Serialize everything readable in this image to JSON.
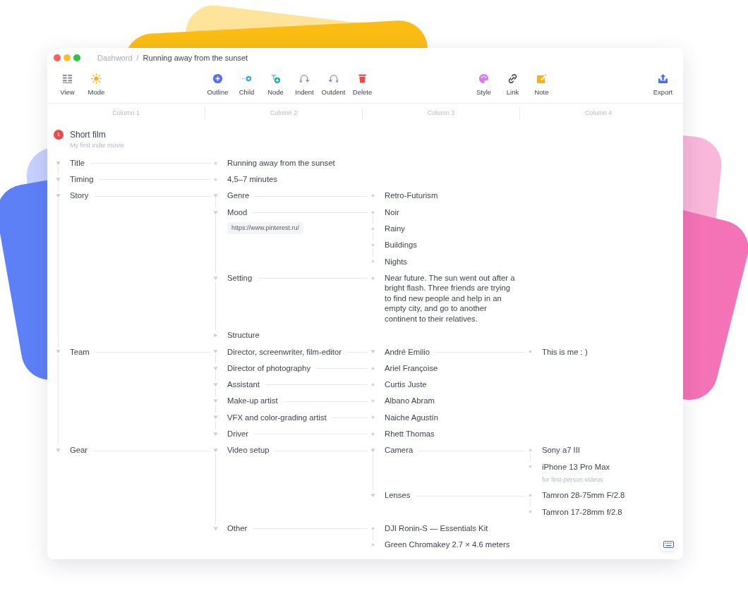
{
  "window": {
    "traffic_lights": [
      {
        "color": "#fe5f57"
      },
      {
        "color": "#febc2e"
      },
      {
        "color": "#28c840"
      }
    ],
    "breadcrumb": [
      {
        "label": "Dashword",
        "current": false
      },
      {
        "label": "Running away from the sunset",
        "current": true
      }
    ],
    "breadcrumb_separator": "/"
  },
  "toolbar": {
    "groups": [
      {
        "items": [
          {
            "label": "View"
          },
          {
            "label": "Mode"
          }
        ]
      },
      {
        "items": [
          {
            "label": "Outline"
          },
          {
            "label": "Child"
          },
          {
            "label": "Node"
          },
          {
            "label": "Indent"
          },
          {
            "label": "Outdent"
          },
          {
            "label": "Delete"
          }
        ]
      },
      {
        "items": [
          {
            "label": "Style"
          },
          {
            "label": "Link"
          },
          {
            "label": "Note"
          }
        ]
      },
      {
        "items": [
          {
            "label": "Export"
          }
        ]
      }
    ]
  },
  "columns": [
    "Column 1",
    "Column 2",
    "Column 3",
    "Column 4"
  ],
  "document": {
    "number": "1",
    "title": "Short film",
    "subtitle": "My first indie movie"
  },
  "tree": [
    {
      "label": "Title",
      "expanded": true,
      "children": [
        {
          "label": "Running away from the sunset"
        }
      ]
    },
    {
      "label": "Timing",
      "expanded": true,
      "children": [
        {
          "label": "4,5–7 minutes"
        }
      ]
    },
    {
      "label": "Story",
      "expanded": true,
      "children": [
        {
          "label": "Genre",
          "expanded": true,
          "children": [
            {
              "label": "Retro-Futurism"
            }
          ]
        },
        {
          "label": "Mood",
          "expanded": true,
          "link": "https://www.pinterest.ru/",
          "children": [
            {
              "label": "Noir"
            },
            {
              "label": "Rainy"
            },
            {
              "label": "Buildings"
            },
            {
              "label": "Nights"
            }
          ]
        },
        {
          "label": "Setting",
          "expanded": true,
          "children": [
            {
              "label": "Near future. The sun went out after a bright flash. Three friends are trying to find new people and help in an empty city, and go to another continent to their relatives."
            }
          ]
        },
        {
          "label": "Structure",
          "expanded": false
        }
      ]
    },
    {
      "label": "Team",
      "expanded": true,
      "children": [
        {
          "label": "Director, screenwriter, film-editor",
          "expanded": true,
          "children": [
            {
              "label": "André Emilio",
              "expanded": true,
              "children": [
                {
                  "label": "This is me : )"
                }
              ]
            }
          ]
        },
        {
          "label": "Director of photography",
          "expanded": true,
          "children": [
            {
              "label": "Ariel Françoise"
            }
          ]
        },
        {
          "label": "Assistant",
          "expanded": true,
          "children": [
            {
              "label": "Curtis Juste"
            }
          ]
        },
        {
          "label": "Make-up artist",
          "expanded": true,
          "children": [
            {
              "label": "Albano Abram"
            }
          ]
        },
        {
          "label": "VFX and color-grading artist",
          "expanded": true,
          "children": [
            {
              "label": "Naiche Agustín"
            }
          ]
        },
        {
          "label": "Driver",
          "expanded": true,
          "children": [
            {
              "label": "Rhett Thomas"
            }
          ]
        }
      ]
    },
    {
      "label": "Gear",
      "expanded": true,
      "children": [
        {
          "label": "Video setup",
          "expanded": true,
          "children": [
            {
              "label": "Camera",
              "expanded": true,
              "children": [
                {
                  "label": "Sony a7 III"
                },
                {
                  "label": "iPhone 13 Pro Max",
                  "note": "for first-person videos"
                }
              ]
            },
            {
              "label": "Lenses",
              "expanded": true,
              "children": [
                {
                  "label": "Tamron 28-75mm F/2.8"
                },
                {
                  "label": "Tamron 17-28mm f/2.8"
                }
              ]
            }
          ]
        },
        {
          "label": "Other",
          "expanded": true,
          "children": [
            {
              "label": "DJI Ronin-S — Essentials Kit"
            },
            {
              "label": "Green Chromakey 2.7 × 4.6 meters"
            }
          ]
        }
      ]
    }
  ]
}
